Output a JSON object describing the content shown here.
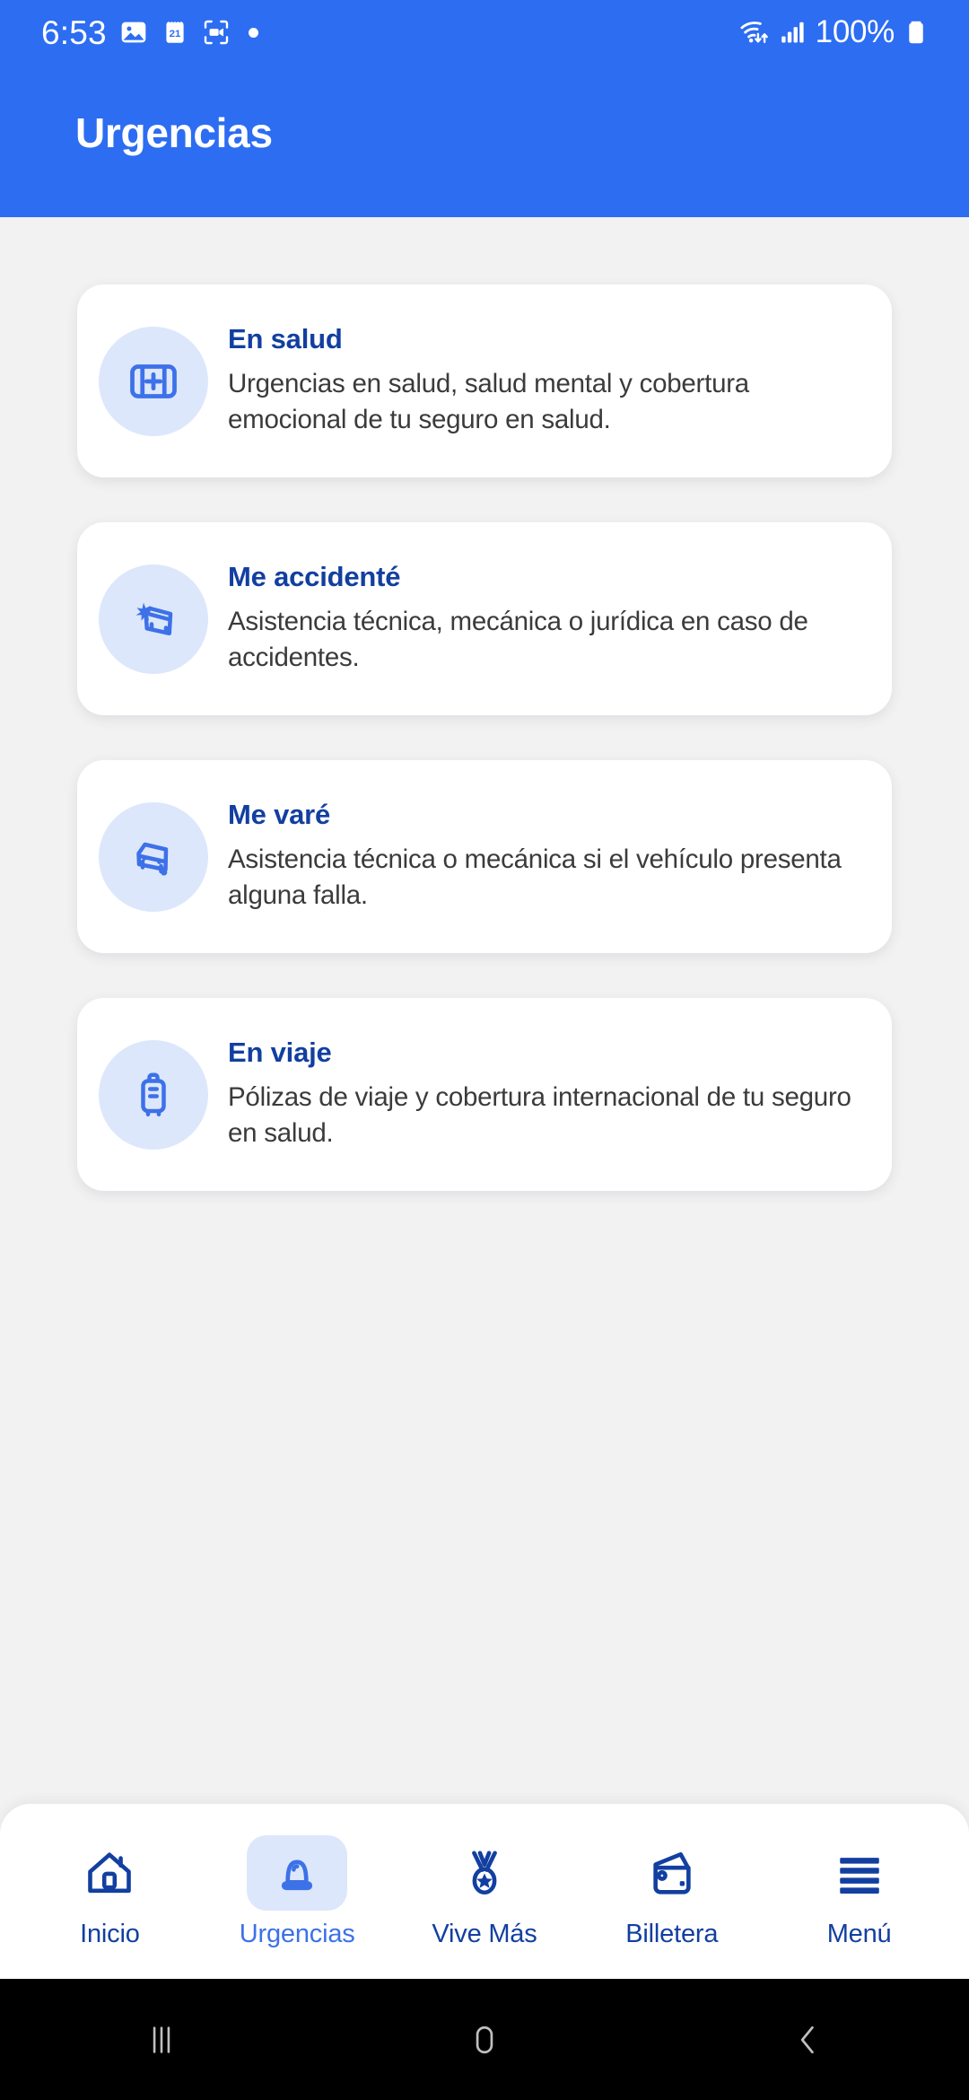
{
  "status_bar": {
    "clock": "6:53",
    "battery_percent": "100%",
    "left_icons": [
      "image-icon",
      "calendar-icon",
      "screen-record-icon",
      "dot-indicator-icon"
    ],
    "calendar_day": "21",
    "right_icons": [
      "wifi-icon",
      "cellular-signal-icon",
      "battery-icon"
    ]
  },
  "header": {
    "title": "Urgencias",
    "background_color": "#2C6DF2",
    "title_color": "#FFFFFF"
  },
  "theme": {
    "page_background": "#F2F2F2",
    "card_background": "#FFFFFF",
    "icon_circle": "#DDE7FC",
    "icon_blue": "#3D71E8",
    "title_navy": "#123FA0",
    "body_gray": "#3B3B3B",
    "accent_blue": "#2C6DF2"
  },
  "cards": [
    {
      "icon": "first-aid-kit-icon",
      "title": "En salud",
      "description": "Urgencias en salud, salud mental y cobertura emocional de tu seguro en salud."
    },
    {
      "icon": "car-crash-icon",
      "title": "Me accidenté",
      "description": "Asistencia técnica, mecánica o jurídica en caso de accidentes."
    },
    {
      "icon": "car-breakdown-icon",
      "title": "Me varé",
      "description": "Asistencia técnica o mecánica si el vehículo presenta alguna falla."
    },
    {
      "icon": "suitcase-icon",
      "title": "En viaje",
      "description": "Pólizas de viaje y cobertura internacional de tu seguro en salud."
    }
  ],
  "bottom_nav": {
    "items": [
      {
        "icon": "home-icon",
        "label": "Inicio",
        "active": false
      },
      {
        "icon": "siren-icon",
        "label": "Urgencias",
        "active": true
      },
      {
        "icon": "medal-icon",
        "label": "Vive Más",
        "active": false
      },
      {
        "icon": "wallet-icon",
        "label": "Billetera",
        "active": false
      },
      {
        "icon": "hamburger-icon",
        "label": "Menú",
        "active": false
      }
    ]
  },
  "system_nav": {
    "buttons": [
      "recents-icon",
      "home-circle-icon",
      "back-icon"
    ]
  }
}
